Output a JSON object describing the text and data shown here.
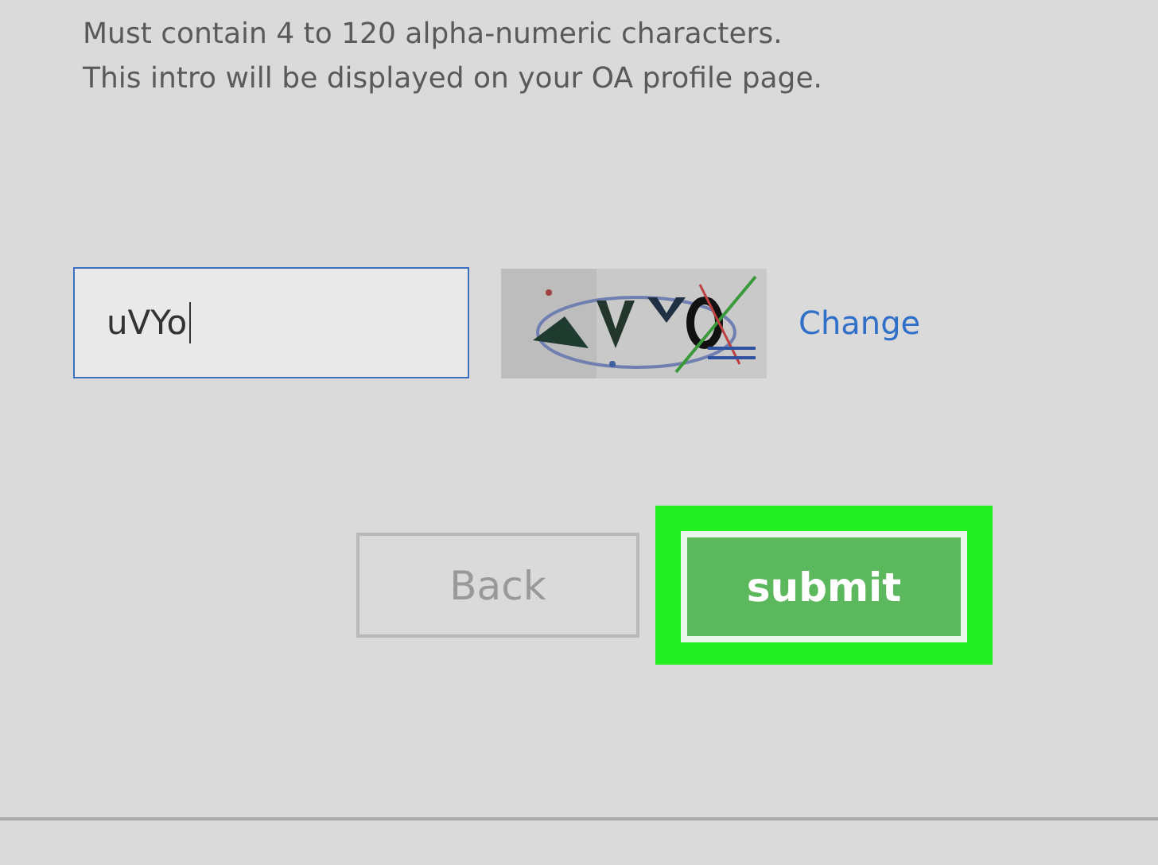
{
  "intro_hint": [
    "Must contain 4 to 120 alpha-numeric characters.",
    "This intro will be displayed on your OA profile page."
  ],
  "captcha": {
    "value": "uVYo",
    "change_link": "Change"
  },
  "buttons": {
    "back": "Back",
    "submit": "submit",
    "submit_highlighted": true
  }
}
